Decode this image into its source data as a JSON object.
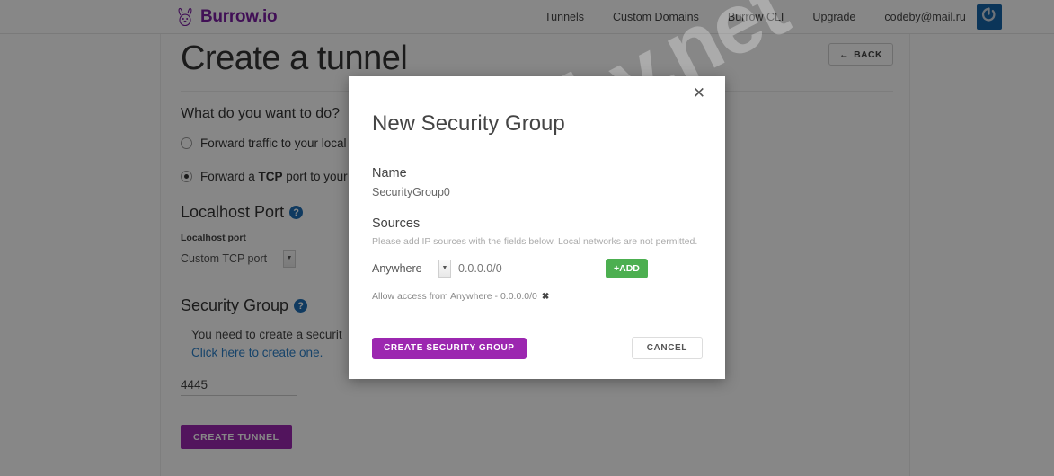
{
  "header": {
    "brand": "Burrow.io",
    "brand_color": "#7b1fa2",
    "logo_icon": "rabbit-icon",
    "nav": [
      {
        "label": "Tunnels"
      },
      {
        "label": "Custom Domains"
      },
      {
        "label": "Burrow CLI"
      },
      {
        "label": "Upgrade"
      }
    ],
    "user_email": "codeby@mail.ru",
    "avatar_icon": "power-icon",
    "avatar_color": "#1565a8"
  },
  "page": {
    "title": "Create a tunnel",
    "back_button": "BACK",
    "back_icon": "arrow-left-icon"
  },
  "form": {
    "question": "What do you want to do?",
    "options": [
      {
        "label": "Forward traffic to your local",
        "selected": false
      },
      {
        "label_pre": "Forward a ",
        "label_strong": "TCP",
        "label_post": " port to your",
        "selected": true
      }
    ],
    "localhost_port": {
      "heading": "Localhost Port",
      "help_icon": "question-circle-icon",
      "field_label": "Localhost port",
      "select_value": "Custom TCP port"
    },
    "security_group": {
      "heading": "Security Group",
      "help_icon": "question-circle-icon",
      "note": "You need to create a securit",
      "link": "Click here to create one.",
      "link_color": "#2a7fc9",
      "port_value": "4445"
    },
    "submit_label": "CREATE TUNNEL",
    "submit_color": "#9c27b0"
  },
  "watermark": "codeby.net",
  "modal": {
    "title": "New Security Group",
    "close_icon": "close-icon",
    "name_label": "Name",
    "name_value": "SecurityGroup0",
    "sources_label": "Sources",
    "sources_hint": "Please add IP sources with the fields below. Local networks are not permitted.",
    "source_select_value": "Anywhere",
    "source_select_icon": "chevron-down-icon",
    "source_input_placeholder": "0.0.0.0/0",
    "add_label": "+ADD",
    "add_color": "#4caf50",
    "tag_text": "Allow access from Anywhere - 0.0.0.0/0",
    "tag_remove_icon": "remove-icon",
    "create_label": "CREATE SECURITY GROUP",
    "create_color": "#9c27b0",
    "cancel_label": "CANCEL"
  }
}
